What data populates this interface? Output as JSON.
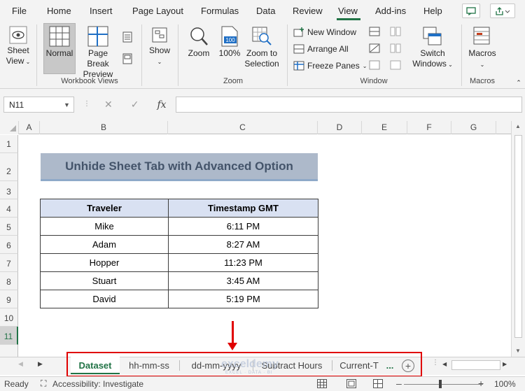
{
  "menu": {
    "items": [
      "File",
      "Home",
      "Insert",
      "Page Layout",
      "Formulas",
      "Data",
      "Review",
      "View",
      "Add-ins",
      "Help"
    ],
    "active": "View"
  },
  "ribbon": {
    "sheet_view": {
      "line1": "Sheet",
      "line2": "View"
    },
    "normal": "Normal",
    "page_break": {
      "line1": "Page Break",
      "line2": "Preview"
    },
    "show": "Show",
    "zoom": "Zoom",
    "zoom100": "100%",
    "zoom_to_selection": {
      "line1": "Zoom to",
      "line2": "Selection"
    },
    "new_window": "New Window",
    "arrange_all": "Arrange All",
    "freeze_panes": "Freeze Panes",
    "switch_windows": {
      "line1": "Switch",
      "line2": "Windows"
    },
    "macros": "Macros",
    "groups": {
      "workbook_views": "Workbook Views",
      "zoom": "Zoom",
      "window": "Window",
      "macros": "Macros"
    }
  },
  "formula_bar": {
    "name_box": "N11",
    "fx": "fx",
    "formula": ""
  },
  "grid": {
    "columns": [
      "A",
      "B",
      "C",
      "D",
      "E",
      "F",
      "G"
    ],
    "rows": [
      "1",
      "2",
      "3",
      "4",
      "5",
      "6",
      "7",
      "8",
      "9",
      "10",
      "11"
    ],
    "selected_row": "11"
  },
  "sheet": {
    "title": "Unhide Sheet Tab with Advanced Option",
    "headers": [
      "Traveler",
      "Timestamp GMT"
    ],
    "rows": [
      [
        "Mike",
        "6:11 PM"
      ],
      [
        "Adam",
        "8:27 AM"
      ],
      [
        "Hopper",
        "11:23 PM"
      ],
      [
        "Stuart",
        "3:45 AM"
      ],
      [
        "David",
        "5:19 PM"
      ]
    ]
  },
  "tabs": {
    "items": [
      "Dataset",
      "hh-mm-ss",
      "dd-mm-yyyy",
      "Subtract Hours",
      "Current-T"
    ],
    "active": "Dataset",
    "more": "...",
    "watermark": "exceldemy",
    "watermark_sub": "EXCEL · DATA · BI"
  },
  "status": {
    "ready": "Ready",
    "accessibility": "Accessibility: Investigate",
    "zoom": "100%"
  },
  "colors": {
    "accent": "#217346",
    "highlight": "#e00000",
    "title_fill": "#adb9ca",
    "header_fill": "#d9e1f2"
  }
}
